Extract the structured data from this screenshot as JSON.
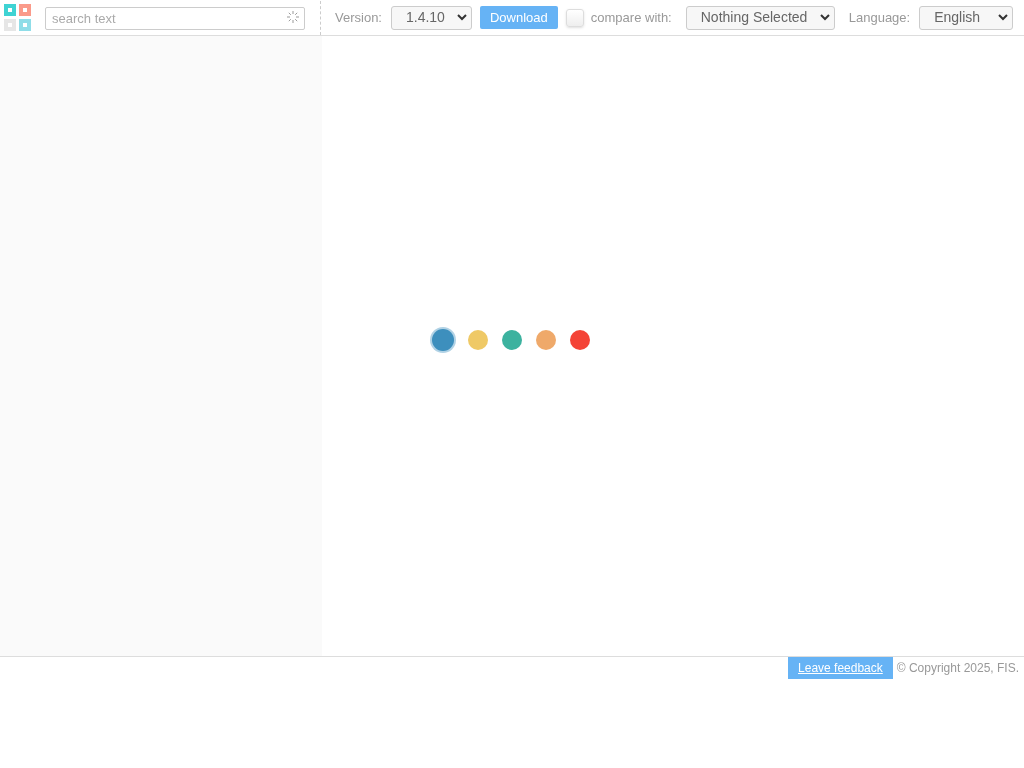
{
  "search": {
    "placeholder": "search text"
  },
  "toolbar": {
    "version_label": "Version:",
    "version": "1.4.10",
    "download": "Download",
    "compare_checked": false,
    "compare_label": "compare with:",
    "compare_value": "Nothing Selected",
    "language_label": "Language:",
    "language": "English"
  },
  "loader_dots": [
    {
      "color": "#3d8fbd",
      "selected": true
    },
    {
      "color": "#efc966",
      "selected": false
    },
    {
      "color": "#3cb29f",
      "selected": false
    },
    {
      "color": "#efa96a",
      "selected": false
    },
    {
      "color": "#f44336",
      "selected": false
    }
  ],
  "footer": {
    "feedback": "Leave feedback",
    "copyright": "© Copyright 2025, FIS."
  }
}
